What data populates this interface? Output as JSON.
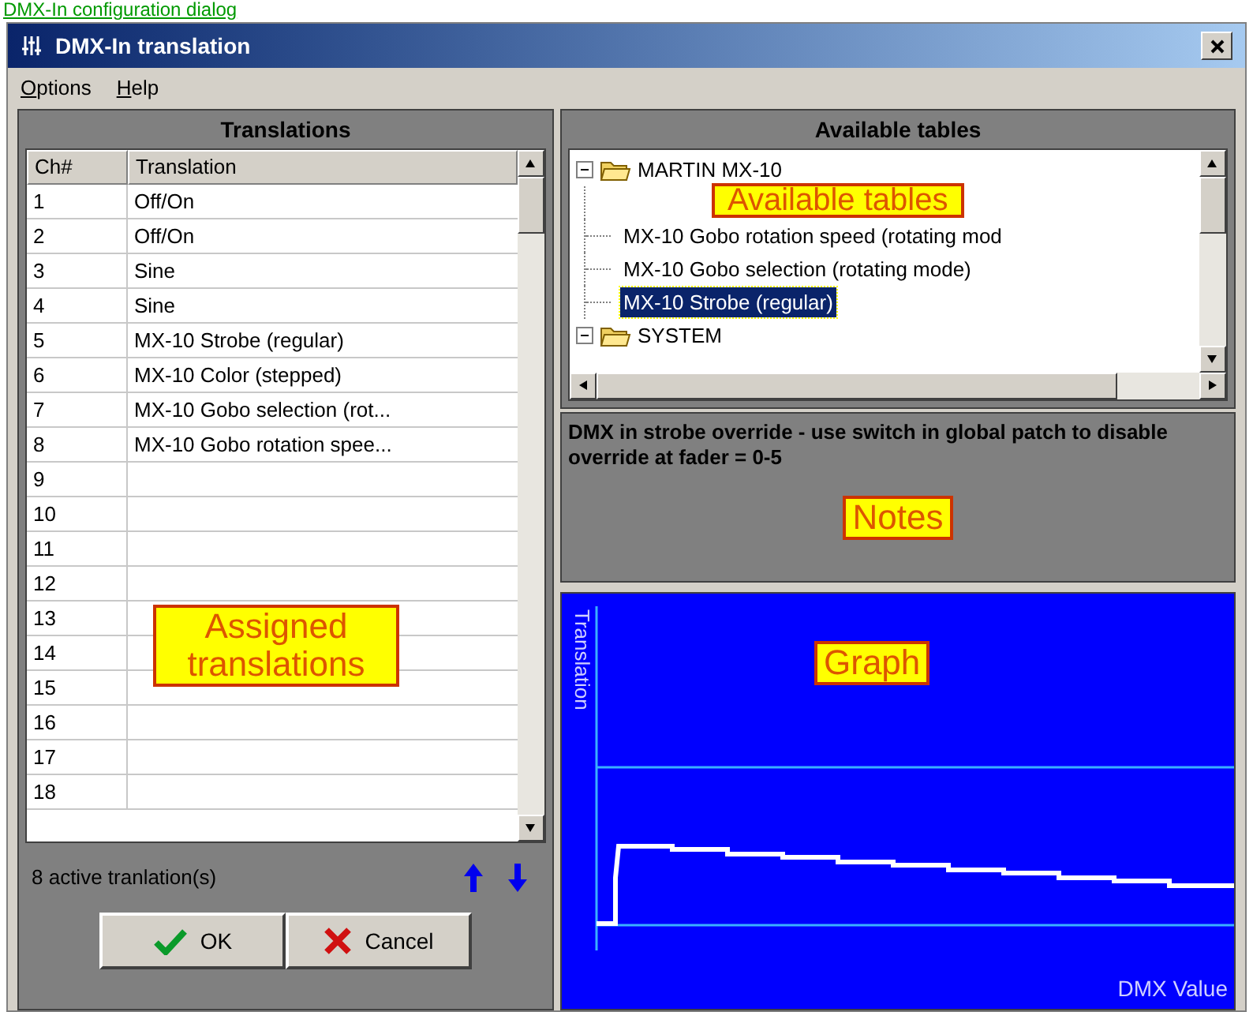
{
  "link": {
    "text": "DMX-In configuration dialog"
  },
  "window": {
    "title": "DMX-In translation"
  },
  "menu": [
    {
      "label": "Options"
    },
    {
      "label": "Help"
    }
  ],
  "translations": {
    "title": "Translations",
    "columns": [
      "Ch#",
      "Translation"
    ],
    "rows": [
      {
        "ch": "1",
        "translation": "Off/On"
      },
      {
        "ch": "2",
        "translation": "Off/On"
      },
      {
        "ch": "3",
        "translation": "Sine"
      },
      {
        "ch": "4",
        "translation": "Sine"
      },
      {
        "ch": "5",
        "translation": "MX-10 Strobe (regular)"
      },
      {
        "ch": "6",
        "translation": "MX-10 Color (stepped)"
      },
      {
        "ch": "7",
        "translation": "MX-10 Gobo selection (rot..."
      },
      {
        "ch": "8",
        "translation": "MX-10 Gobo rotation spee..."
      },
      {
        "ch": "9"
      },
      {
        "ch": "10"
      },
      {
        "ch": "11"
      },
      {
        "ch": "12"
      },
      {
        "ch": "13"
      },
      {
        "ch": "14"
      },
      {
        "ch": "15"
      },
      {
        "ch": "16"
      },
      {
        "ch": "17"
      },
      {
        "ch": "18"
      }
    ],
    "callout": "Assigned translations",
    "status": "8 active tranlation(s)"
  },
  "available_tables": {
    "title": "Available tables",
    "callout": "Available tables",
    "tree": [
      {
        "label": "MARTIN MX-10",
        "expanded": true,
        "children": [
          {
            "label": "MX-10 Gobo rotation speed (rotating mod",
            "selected": false
          },
          {
            "label": "MX-10 Gobo selection (rotating mode)",
            "selected": false
          },
          {
            "label": "MX-10 Strobe (regular)",
            "selected": true
          }
        ]
      },
      {
        "label": "SYSTEM",
        "expanded": true
      }
    ]
  },
  "notes": {
    "text": "DMX in strobe override - use switch in global patch to disable override at fader = 0-5",
    "callout": "Notes"
  },
  "graph": {
    "ylabel": "Translation",
    "xlabel": "DMX Value",
    "callout": "Graph"
  },
  "buttons": [
    {
      "label": "OK",
      "kind": "ok"
    },
    {
      "label": "Cancel",
      "kind": "cancel"
    }
  ]
}
